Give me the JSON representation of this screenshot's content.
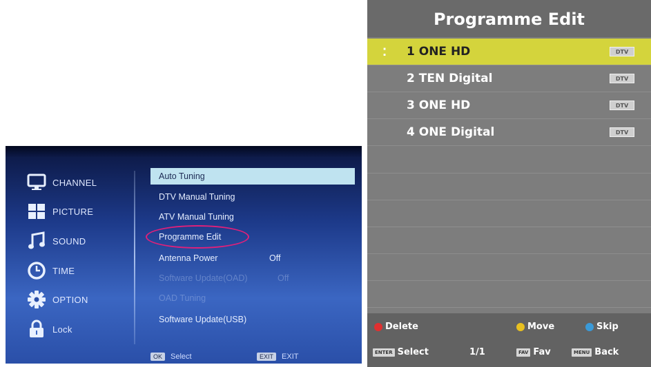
{
  "setup_menu": {
    "categories": [
      {
        "label": "CHANNEL",
        "icon": "monitor-icon"
      },
      {
        "label": "PICTURE",
        "icon": "grid-icon"
      },
      {
        "label": "SOUND",
        "icon": "music-note-icon"
      },
      {
        "label": "TIME",
        "icon": "clock-icon"
      },
      {
        "label": "OPTION",
        "icon": "gear-icon"
      },
      {
        "label": "Lock",
        "icon": "lock-icon"
      }
    ],
    "options": [
      {
        "label": "Auto Tuning"
      },
      {
        "label": "DTV Manual Tuning"
      },
      {
        "label": "ATV Manual Tuning"
      },
      {
        "label": "Programme Edit"
      },
      {
        "label": "Antenna Power",
        "value": "Off"
      },
      {
        "label": "Software Update(OAD)",
        "value": "Off"
      },
      {
        "label": "OAD Tuning"
      },
      {
        "label": "Software Update(USB)"
      }
    ],
    "bottom_bar": {
      "ok_key": "OK",
      "ok_label": "Select",
      "exit_key": "EXIT",
      "exit_label": "EXIT"
    },
    "highlight_color": "#e0207a"
  },
  "programme_edit": {
    "title": "Programme Edit",
    "channels": [
      {
        "name": "1 ONE HD",
        "badge": "DTV"
      },
      {
        "name": "2 TEN Digital",
        "badge": "DTV"
      },
      {
        "name": "3 ONE HD",
        "badge": "DTV"
      },
      {
        "name": "4 ONE Digital",
        "badge": "DTV"
      }
    ],
    "legend": {
      "delete": "Delete",
      "move": "Move",
      "skip": "Skip",
      "enter_key": "ENTER",
      "select": "Select",
      "page": "1/1",
      "fav_key": "FAV",
      "fav": "Fav",
      "menu_key": "MENU",
      "back": "Back"
    },
    "colors": {
      "selected_row": "#d4d43c",
      "delete": "#e03030",
      "move": "#e8c020",
      "skip": "#3a9ad8"
    }
  }
}
